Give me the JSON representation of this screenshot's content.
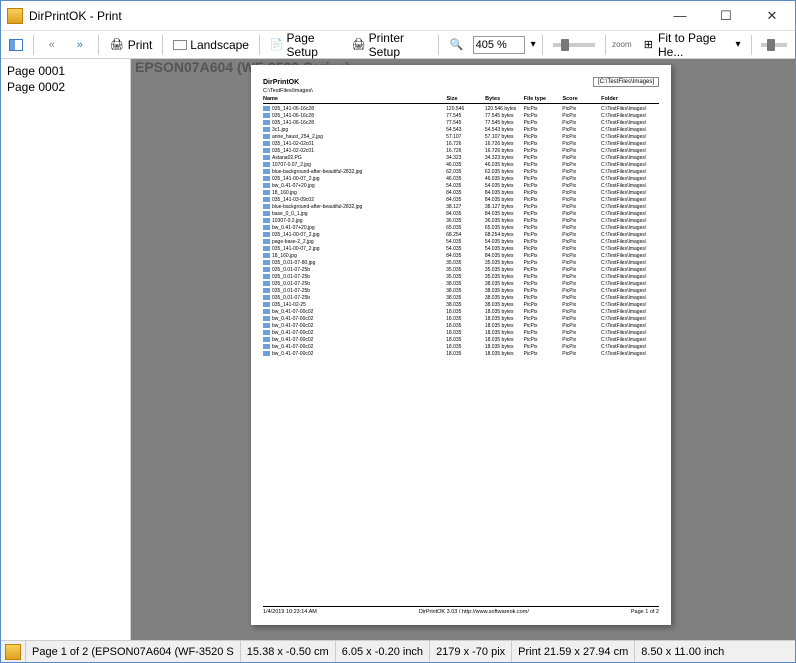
{
  "window": {
    "title": "DirPrintOK - Print"
  },
  "toolbar": {
    "print": "Print",
    "landscape": "Landscape",
    "page_setup": "Page Setup",
    "printer_setup": "Printer Setup",
    "zoom_value": "405 %",
    "zoom_label": "zoom",
    "fit": "Fit to Page He..."
  },
  "sidebar": {
    "pages": [
      "Page 0001",
      "Page 0002"
    ]
  },
  "overlay": {
    "printer": "EPSON07A604 (WF-3520 Series)"
  },
  "page": {
    "title": "DirPrintOK",
    "pathbox": "[C:\\TestFiles\\Images]",
    "subpath": "C:\\TestFiles\\Images\\",
    "cols": {
      "name": "Name",
      "size": "Size",
      "bytes": "Bytes",
      "filetype": "File type",
      "score": "Score",
      "folder": "Folder"
    },
    "footer": {
      "left": "1/4/2019 10:23:14 AM",
      "center": "DirPrintOK 3.03 / http://www.softwareok.com/",
      "right": "Page 1 of 2"
    },
    "rows": [
      {
        "name": "035_141-06-16c28",
        "size": "120.546",
        "bytes": "120.546 bytes",
        "type": "PicPix",
        "folder": "C:\\TestFiles\\Images\\"
      },
      {
        "name": "035_141-06-16c28",
        "size": "77.545",
        "bytes": "77.545 bytes",
        "type": "PicPix",
        "folder": "C:\\TestFiles\\Images\\"
      },
      {
        "name": "035_141-06-16c28",
        "size": "77.545",
        "bytes": "77.545 bytes",
        "type": "PicPix",
        "folder": "C:\\TestFiles\\Images\\"
      },
      {
        "name": "3c1.jpg",
        "size": "54.543",
        "bytes": "54.543 bytes",
        "type": "PicPix",
        "folder": "C:\\TestFiles\\Images\\"
      },
      {
        "name": "anne_haust_254_2.jpg",
        "size": "57.107",
        "bytes": "57.107 bytes",
        "type": "PicPix",
        "folder": "C:\\TestFiles\\Images\\"
      },
      {
        "name": "035_141-02-02c01",
        "size": "16.726",
        "bytes": "16.726 bytes",
        "type": "PicPix",
        "folder": "C:\\TestFiles\\Images\\"
      },
      {
        "name": "035_141-02-02c01",
        "size": "16.726",
        "bytes": "16.726 bytes",
        "type": "PicPix",
        "folder": "C:\\TestFiles\\Images\\"
      },
      {
        "name": "Astana02.PG",
        "size": "34.323",
        "bytes": "34.323 bytes",
        "type": "PicPix",
        "folder": "C:\\TestFiles\\Images\\"
      },
      {
        "name": "10707-0.07_2.jpg",
        "size": "46.035",
        "bytes": "46.035 bytes",
        "type": "PicPix",
        "folder": "C:\\TestFiles\\Images\\"
      },
      {
        "name": "blue-background-after-beautiful-2832.jpg",
        "size": "62.035",
        "bytes": "62.035 bytes",
        "type": "PicPix",
        "folder": "C:\\TestFiles\\Images\\"
      },
      {
        "name": "035_141-00-07_2.jpg",
        "size": "46.035",
        "bytes": "46.035 bytes",
        "type": "PicPix",
        "folder": "C:\\TestFiles\\Images\\"
      },
      {
        "name": "bw_0.41-07+20.jpg",
        "size": "54.035",
        "bytes": "54.035 bytes",
        "type": "PicPix",
        "folder": "C:\\TestFiles\\Images\\"
      },
      {
        "name": "18_160.jpg",
        "size": "84.035",
        "bytes": "84.035 bytes",
        "type": "PicPix",
        "folder": "C:\\TestFiles\\Images\\"
      },
      {
        "name": "035_141-03-09c02",
        "size": "84.035",
        "bytes": "84.035 bytes",
        "type": "PicPix",
        "folder": "C:\\TestFiles\\Images\\"
      },
      {
        "name": "blue-background-after-beautiful-2832.jpg",
        "size": "38.127",
        "bytes": "38.127 bytes",
        "type": "PicPix",
        "folder": "C:\\TestFiles\\Images\\"
      },
      {
        "name": "base_0_0_1.jpg",
        "size": "84.035",
        "bytes": "84.035 bytes",
        "type": "PicPix",
        "folder": "C:\\TestFiles\\Images\\"
      },
      {
        "name": "10307-0.2.jpg",
        "size": "36.035",
        "bytes": "36.035 bytes",
        "type": "PicPix",
        "folder": "C:\\TestFiles\\Images\\"
      },
      {
        "name": "bw_0.41-07+20.jpg",
        "size": "65.035",
        "bytes": "65.035 bytes",
        "type": "PicPix",
        "folder": "C:\\TestFiles\\Images\\"
      },
      {
        "name": "035_141-00-07_2.jpg",
        "size": "68.254",
        "bytes": "68.254 bytes",
        "type": "PicPix",
        "folder": "C:\\TestFiles\\Images\\"
      },
      {
        "name": "page-base-2_2.jpg",
        "size": "54.035",
        "bytes": "54.035 bytes",
        "type": "PicPix",
        "folder": "C:\\TestFiles\\Images\\"
      },
      {
        "name": "035_141-00-07_2.jpg",
        "size": "54.035",
        "bytes": "54.035 bytes",
        "type": "PicPix",
        "folder": "C:\\TestFiles\\Images\\"
      },
      {
        "name": "18_160.jpg",
        "size": "84.035",
        "bytes": "84.035 bytes",
        "type": "PicPix",
        "folder": "C:\\TestFiles\\Images\\"
      },
      {
        "name": "035_0.01-07-80.jpg",
        "size": "35.035",
        "bytes": "35.035 bytes",
        "type": "PicPix",
        "folder": "C:\\TestFiles\\Images\\"
      },
      {
        "name": "035_0.01-07-25b",
        "size": "35.035",
        "bytes": "35.035 bytes",
        "type": "PicPix",
        "folder": "C:\\TestFiles\\Images\\"
      },
      {
        "name": "035_0.01-07-25b",
        "size": "35.035",
        "bytes": "35.035 bytes",
        "type": "PicPix",
        "folder": "C:\\TestFiles\\Images\\"
      },
      {
        "name": "035_0.01-07-25b",
        "size": "38.035",
        "bytes": "38.035 bytes",
        "type": "PicPix",
        "folder": "C:\\TestFiles\\Images\\"
      },
      {
        "name": "035_0.01-07-25b",
        "size": "38.035",
        "bytes": "38.035 bytes",
        "type": "PicPix",
        "folder": "C:\\TestFiles\\Images\\"
      },
      {
        "name": "035_0.01-07-25b",
        "size": "38.035",
        "bytes": "38.035 bytes",
        "type": "PicPix",
        "folder": "C:\\TestFiles\\Images\\"
      },
      {
        "name": "035_141-02-25",
        "size": "38.035",
        "bytes": "38.035 bytes",
        "type": "PicPix",
        "folder": "C:\\TestFiles\\Images\\"
      },
      {
        "name": "bw_0.41-07-00c02",
        "size": "18.035",
        "bytes": "18.035 bytes",
        "type": "PicPix",
        "folder": "C:\\TestFiles\\Images\\"
      },
      {
        "name": "bw_0.41-07-00c02",
        "size": "18.035",
        "bytes": "18.035 bytes",
        "type": "PicPix",
        "folder": "C:\\TestFiles\\Images\\"
      },
      {
        "name": "bw_0.41-07-00c02",
        "size": "18.035",
        "bytes": "18.035 bytes",
        "type": "PicPix",
        "folder": "C:\\TestFiles\\Images\\"
      },
      {
        "name": "bw_0.41-07-00c02",
        "size": "18.035",
        "bytes": "18.035 bytes",
        "type": "PicPix",
        "folder": "C:\\TestFiles\\Images\\"
      },
      {
        "name": "bw_0.41-07-00c02",
        "size": "18.035",
        "bytes": "18.035 bytes",
        "type": "PicPix",
        "folder": "C:\\TestFiles\\Images\\"
      },
      {
        "name": "bw_0.41-07-00c02",
        "size": "18.035",
        "bytes": "18.035 bytes",
        "type": "PicPix",
        "folder": "C:\\TestFiles\\Images\\"
      },
      {
        "name": "bw_0.41-07-00c02",
        "size": "18.035",
        "bytes": "18.035 bytes",
        "type": "PicPix",
        "folder": "C:\\TestFiles\\Images\\"
      }
    ]
  },
  "status": {
    "page_info": "Page 1 of 2 (EPSON07A604 (WF-3520 S",
    "cursor_cm": "15.38 x -0.50 cm",
    "cursor_in": "6.05 x -0.20 inch",
    "cursor_px": "2179 x -70 pix",
    "print_cm": "Print 21.59 x 27.94 cm",
    "print_in": "8.50 x 11.00 inch"
  }
}
